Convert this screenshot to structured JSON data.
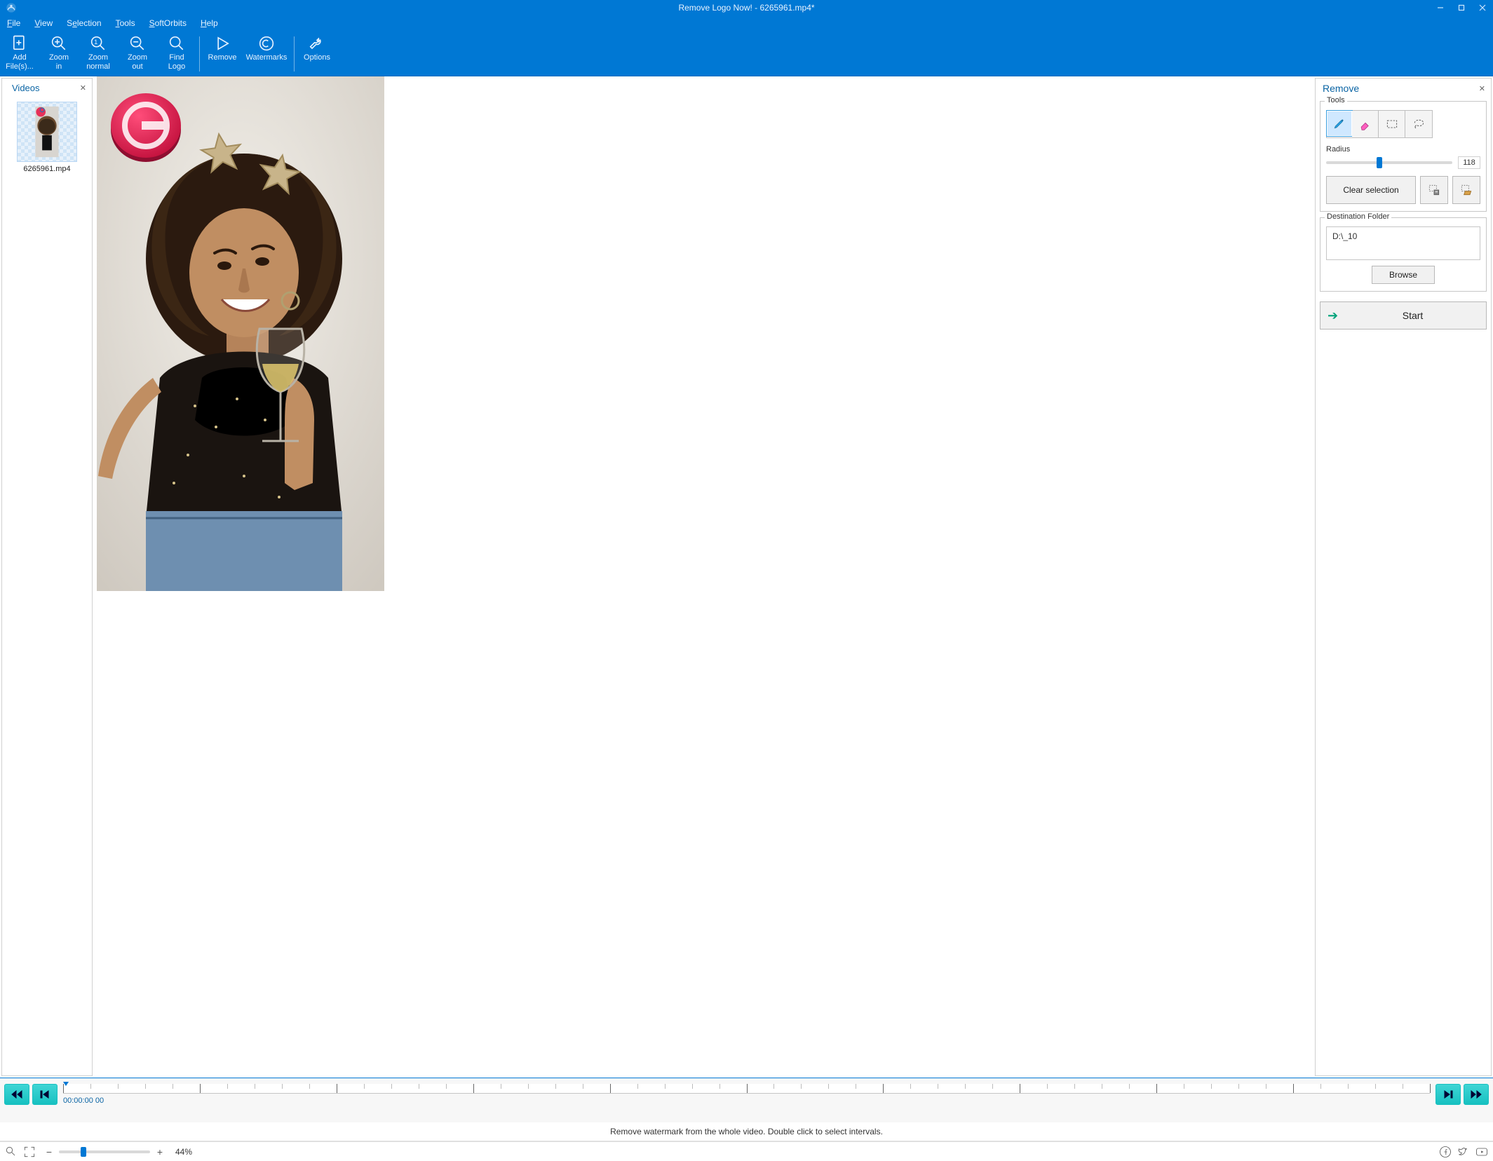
{
  "title": "Remove Logo Now! - 6265961.mp4*",
  "menu": {
    "file": "File",
    "view": "View",
    "selection": "Selection",
    "tools": "Tools",
    "softorbits": "SoftOrbits",
    "help": "Help"
  },
  "toolbar": {
    "add_files": "Add\nFile(s)...",
    "zoom_in": "Zoom\nin",
    "zoom_normal": "Zoom\nnormal",
    "zoom_out": "Zoom\nout",
    "find_logo": "Find\nLogo",
    "remove": "Remove",
    "watermarks": "Watermarks",
    "options": "Options"
  },
  "left_panel": {
    "title": "Videos",
    "items": [
      {
        "caption": "6265961.mp4"
      }
    ]
  },
  "right_panel": {
    "title": "Remove",
    "tools_legend": "Tools",
    "radius_label": "Radius",
    "radius_value": "118",
    "radius_pct": 40,
    "clear_selection": "Clear selection",
    "dest_legend": "Destination Folder",
    "dest_path": "D:\\_10",
    "browse": "Browse",
    "start": "Start"
  },
  "timeline": {
    "timecode": "00:00:00 00"
  },
  "hint": "Remove watermark from the whole video. Double click to select intervals.",
  "status": {
    "zoom": "44%",
    "zoom_pos_pct": 24
  }
}
